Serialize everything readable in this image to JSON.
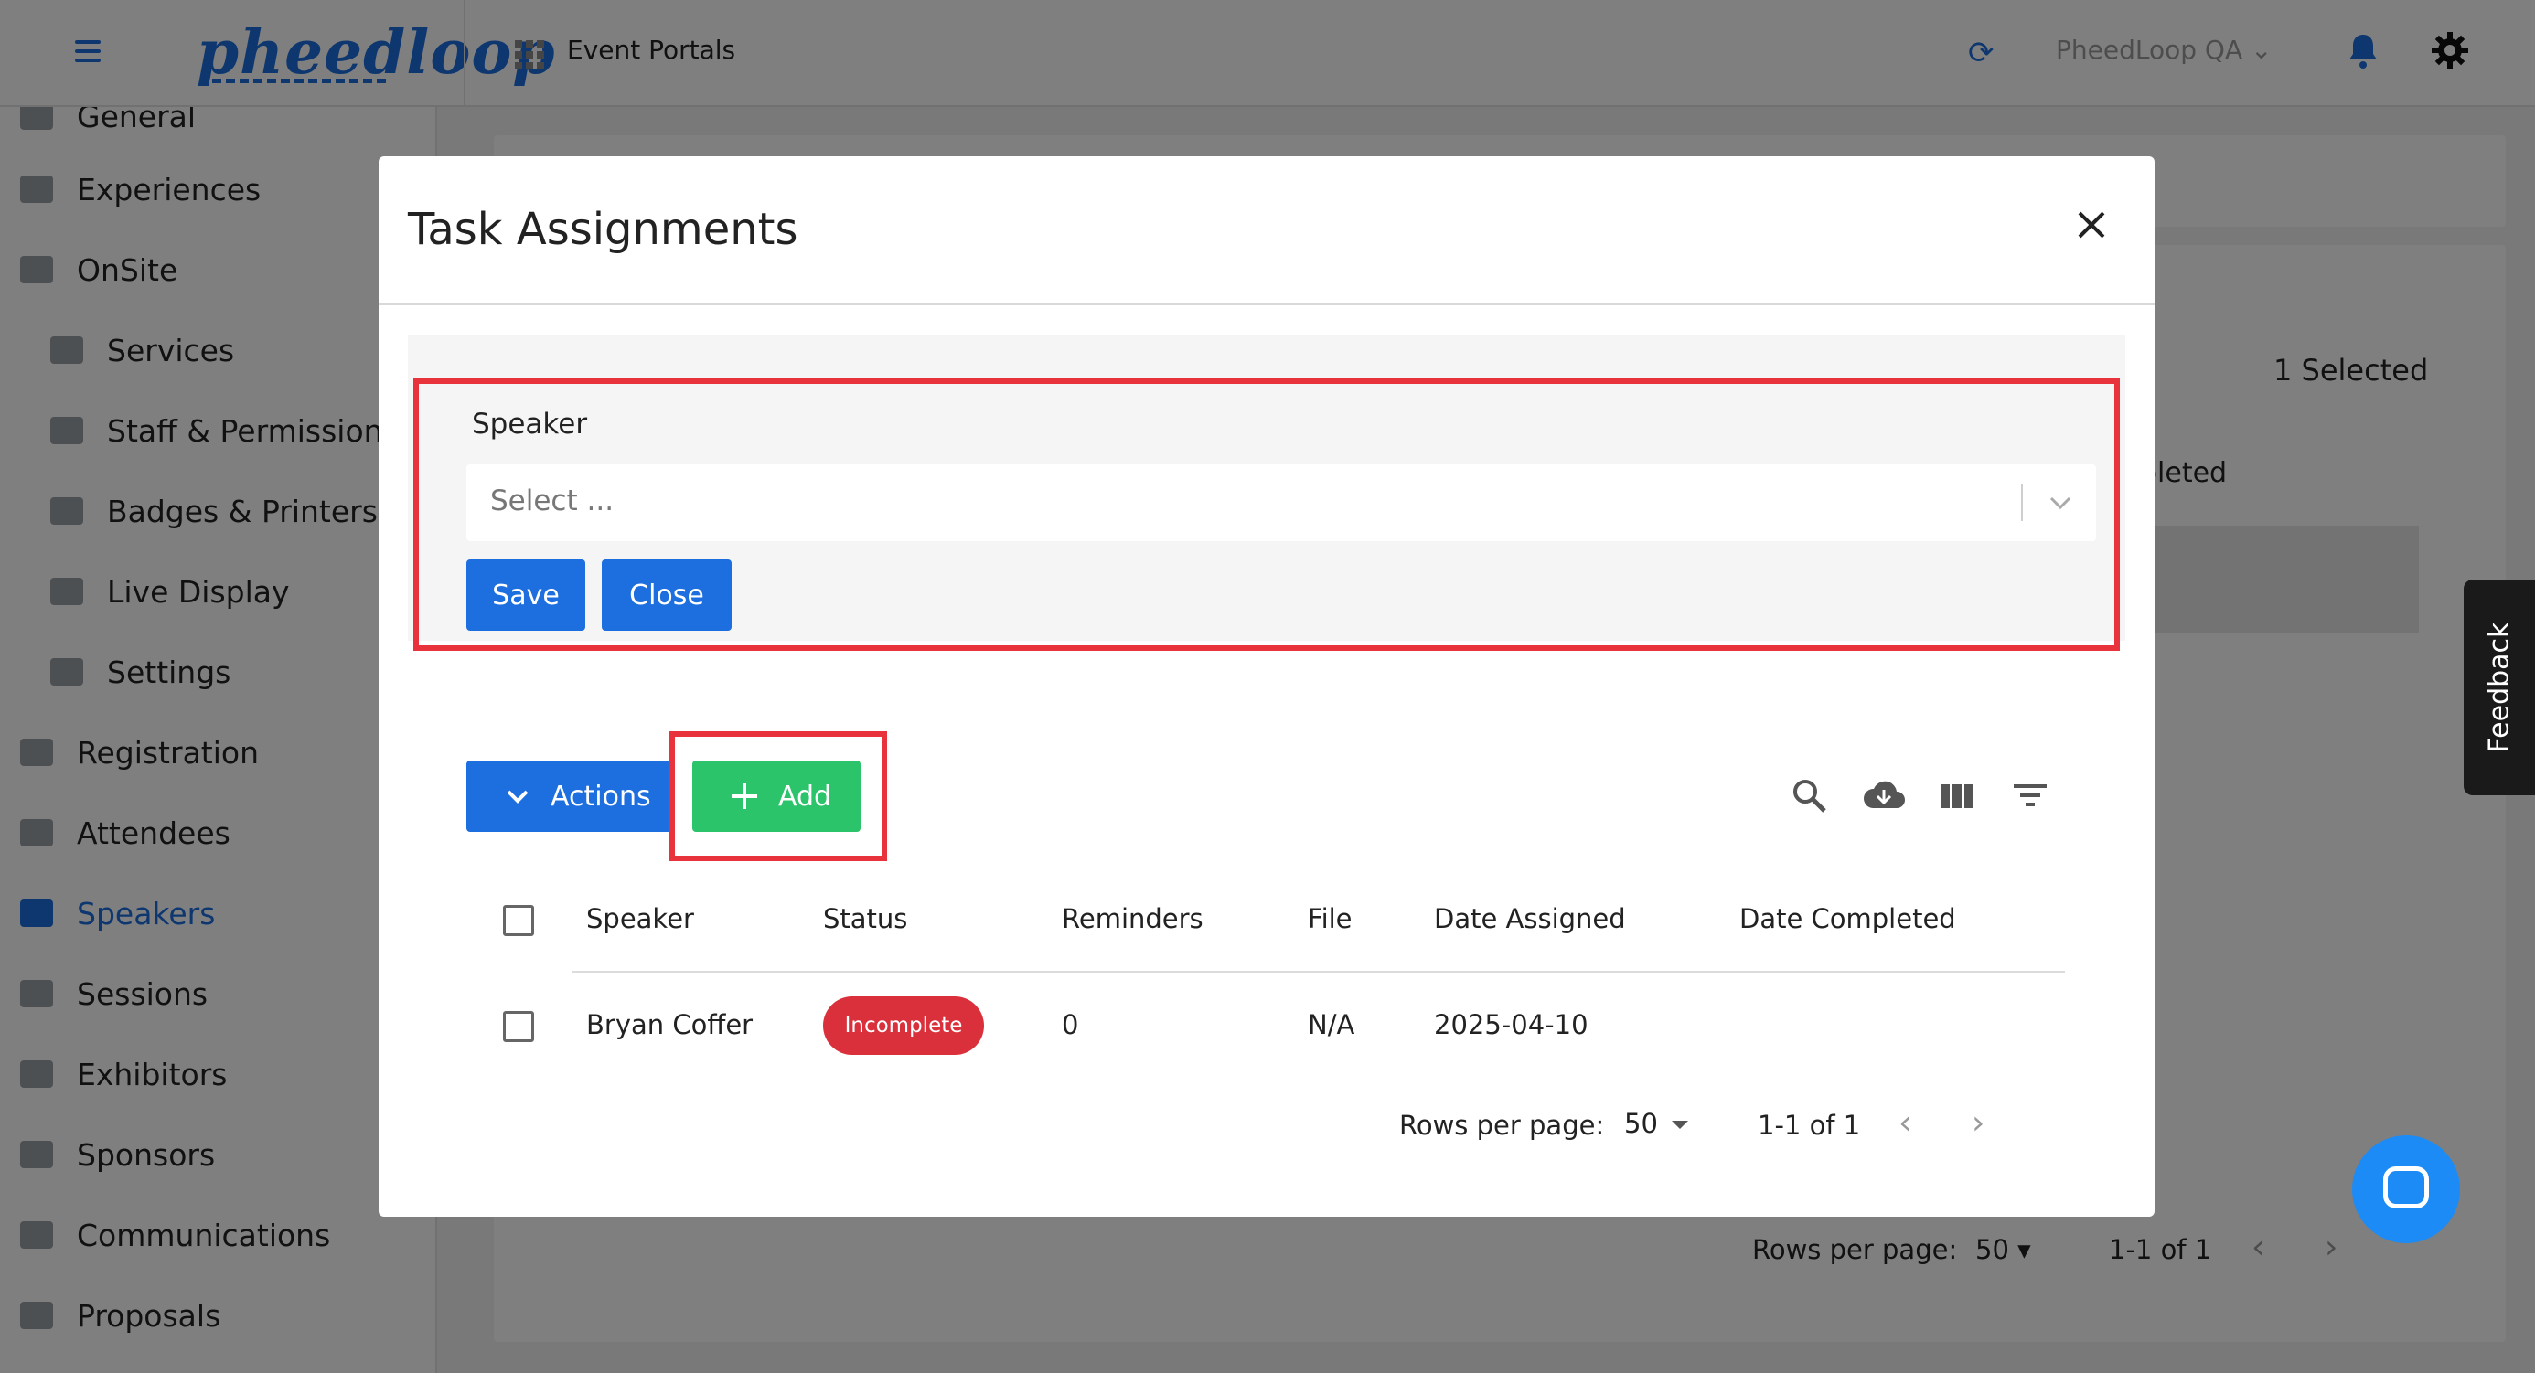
{
  "header": {
    "logo_text": "pheedloop",
    "portal_label": "Event Portals",
    "org_name": "PheedLoop QA ⌄",
    "refresh_icon": "refresh-icon",
    "notifications_icon": "bell-icon",
    "settings_icon": "gear-icon"
  },
  "sidebar": {
    "items": [
      {
        "label": "General",
        "icon": "general-icon"
      },
      {
        "label": "Experiences",
        "icon": "experiences-icon"
      },
      {
        "label": "OnSite",
        "icon": "onsite-icon"
      },
      {
        "label": "Services",
        "icon": "services-icon"
      },
      {
        "label": "Staff & Permissions",
        "icon": "staff-icon"
      },
      {
        "label": "Badges & Printers",
        "icon": "printer-icon"
      },
      {
        "label": "Live Display",
        "icon": "monitor-icon"
      },
      {
        "label": "Settings",
        "icon": "settings-icon"
      },
      {
        "label": "Registration",
        "icon": "cart-icon"
      },
      {
        "label": "Attendees",
        "icon": "attendees-icon"
      },
      {
        "label": "Speakers",
        "icon": "speakers-icon"
      },
      {
        "label": "Sessions",
        "icon": "sessions-icon"
      },
      {
        "label": "Exhibitors",
        "icon": "exhibitors-icon"
      },
      {
        "label": "Sponsors",
        "icon": "sponsors-icon"
      },
      {
        "label": "Communications",
        "icon": "mail-icon"
      },
      {
        "label": "Proposals",
        "icon": "document-icon"
      }
    ],
    "active": "Speakers"
  },
  "background": {
    "selected_text": "1 Selected",
    "completed_text": "pleted",
    "rows_per_page_label": "Rows per page:",
    "rows_per_page_value": "50 ▾",
    "range_text": "1-1 of 1",
    "prev": "‹",
    "next": "›"
  },
  "feedback": {
    "label": "Feedback"
  },
  "chat": {
    "icon": "chat-icon"
  },
  "modal": {
    "title": "Task Assignments",
    "close_icon": "close-icon",
    "form": {
      "speaker_label": "Speaker",
      "select_placeholder": "Select ...",
      "save_label": "Save",
      "close_label": "Close"
    },
    "toolbar": {
      "actions_label": "Actions",
      "add_label": "Add",
      "icons": [
        "search-icon",
        "cloud-download-icon",
        "columns-icon",
        "filter-icon"
      ]
    },
    "table": {
      "columns": [
        "Speaker",
        "Status",
        "Reminders",
        "File",
        "Date Assigned",
        "Date Completed"
      ],
      "rows": [
        {
          "speaker": "Bryan Coffer",
          "status": "Incomplete",
          "reminders": "0",
          "file": "N/A",
          "date_assigned": "2025-04-10",
          "date_completed": ""
        }
      ],
      "status_color": "#d9303b"
    },
    "pagination": {
      "rows_per_page_label": "Rows per page:",
      "rows_per_page_value": "50",
      "range_text": "1-1 of 1",
      "prev": "‹",
      "next": "›"
    }
  },
  "colors": {
    "primary": "#1d6fe0",
    "success": "#2cc46b",
    "highlight_frame": "#e8323c",
    "overlay": "rgba(0,0,0,0.5)"
  }
}
